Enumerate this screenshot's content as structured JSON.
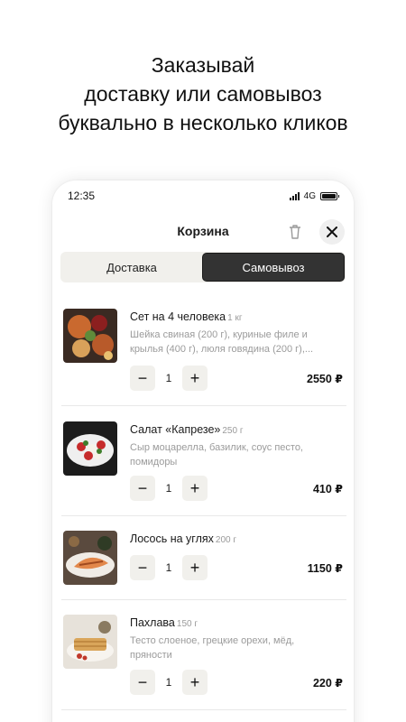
{
  "promo": {
    "line1": "Заказывай",
    "line2": "доставку или самовывоз",
    "line3": "буквально в несколько кликов"
  },
  "status_bar": {
    "time": "12:35",
    "network": "4G"
  },
  "cart": {
    "title": "Корзина",
    "tabs": [
      {
        "label": "Доставка",
        "active": false
      },
      {
        "label": "Самовывоз",
        "active": true
      }
    ],
    "items": [
      {
        "name": "Сет на 4 человека",
        "weight": "1 кг",
        "description": "Шейка свиная (200 г), куриные филе и крылья (400 г), люля говядина (200 г),...",
        "quantity": "1",
        "price": "2550 ₽"
      },
      {
        "name": "Салат «Капрезе»",
        "weight": "250 г",
        "description": "Сыр моцарелла, базилик, соус песто, помидоры",
        "quantity": "1",
        "price": "410 ₽"
      },
      {
        "name": "Лосось на углях",
        "weight": "200 г",
        "description": "",
        "quantity": "1",
        "price": "1150 ₽"
      },
      {
        "name": "Пахлава",
        "weight": "150 г",
        "description": "Тесто слоеное, грецкие орехи, мёд, пряности",
        "quantity": "1",
        "price": "220 ₽"
      }
    ]
  },
  "icons": {
    "trash": "trash-icon",
    "close": "close-icon",
    "minus": "minus-icon",
    "plus": "plus-icon",
    "signal": "signal-icon",
    "battery": "battery-icon"
  },
  "colors": {
    "active_tab": "#333333",
    "tab_bar": "#f1f0ec",
    "stepper_bg": "#f1f0ec",
    "muted_text": "#9b9b9b"
  }
}
